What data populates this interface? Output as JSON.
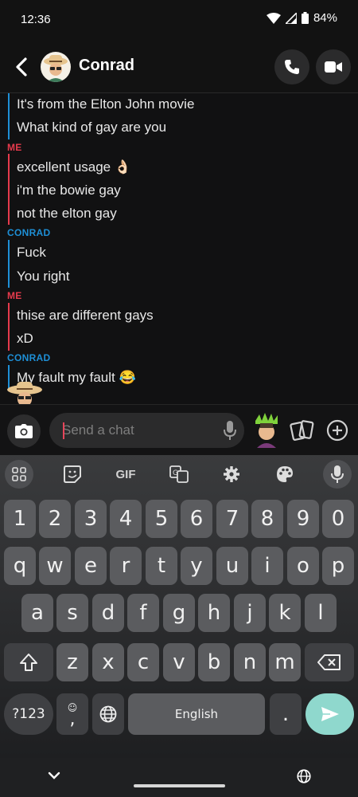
{
  "status": {
    "time": "12:36",
    "battery": "84%"
  },
  "header": {
    "contact_name": "Conrad"
  },
  "messages": [
    {
      "text": "It's from the Elton John movie"
    },
    {
      "text": "What kind of gay are you"
    },
    {
      "sender": "ME"
    },
    {
      "text": "excellent usage 👌🏻"
    },
    {
      "text": "i'm the bowie gay"
    },
    {
      "text": "not the elton gay"
    },
    {
      "sender": "CONRAD"
    },
    {
      "text": "Fuck"
    },
    {
      "text": "You right"
    },
    {
      "sender": "ME"
    },
    {
      "text": "thise are different gays"
    },
    {
      "text": "xD"
    },
    {
      "sender": "CONRAD"
    },
    {
      "text": "My fault my fault 😂"
    }
  ],
  "input": {
    "placeholder": "Send a chat",
    "value": ""
  },
  "keyboard": {
    "toolbar": {
      "gif_label": "GIF"
    },
    "number_row": [
      "1",
      "2",
      "3",
      "4",
      "5",
      "6",
      "7",
      "8",
      "9",
      "0"
    ],
    "row1": [
      "q",
      "w",
      "e",
      "r",
      "t",
      "y",
      "u",
      "i",
      "o",
      "p"
    ],
    "row2": [
      "a",
      "s",
      "d",
      "f",
      "g",
      "h",
      "j",
      "k",
      "l"
    ],
    "row3": [
      "z",
      "x",
      "c",
      "v",
      "b",
      "n",
      "m"
    ],
    "symbols_label": "?123",
    "comma": ",",
    "space_label": "English",
    "period": "."
  },
  "colors": {
    "me": "#e63a4c",
    "conrad": "#1e8fd6",
    "enter": "#8fd8cd"
  }
}
